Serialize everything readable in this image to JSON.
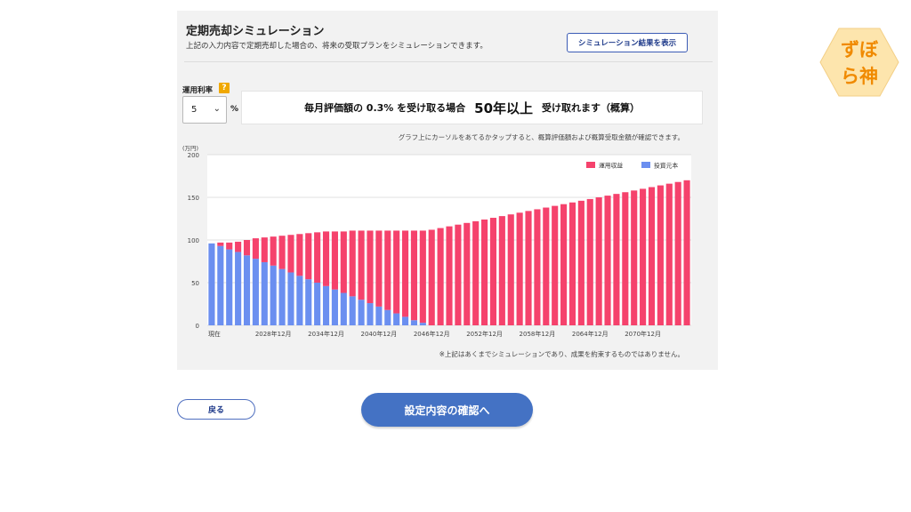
{
  "header": {
    "title": "定期売却シミュレーション",
    "description": "上記の入力内容で定期売却した場合の、将来の受取プランをシミュレーションできます。",
    "sim_button": "シミュレーション結果を表示"
  },
  "rate": {
    "label": "運用利率",
    "help": "?",
    "value": "5",
    "unit": "%"
  },
  "result": {
    "prefix": "毎月評価額の 0.3% を受け取る場合",
    "years": "50年以上",
    "suffix": "受け取れます（概算）"
  },
  "hint": "グラフ上にカーソルをあてるかタップすると、概算評価額および概算受取金額が確認できます。",
  "note": "※上記はあくまでシミュレーションであり、成果を約束するものではありません。",
  "buttons": {
    "back": "戻る",
    "confirm": "設定内容の確認へ"
  },
  "logo": {
    "line1": "ずぼ",
    "line2": "ら神"
  },
  "colors": {
    "gains": "#f5426c",
    "principal": "#6b8ff0",
    "accent": "#4472c4",
    "logo_bg": "#fde5ad",
    "logo_text": "#f08a00"
  },
  "chart_data": {
    "type": "bar",
    "stacked": true,
    "unit_label": "(万円)",
    "ylim": [
      0,
      200
    ],
    "yticks": [
      0,
      50,
      100,
      150,
      200
    ],
    "x_tick_labels": [
      {
        "index": 0,
        "label": "現在"
      },
      {
        "index": 7,
        "label": "2028年12月"
      },
      {
        "index": 13,
        "label": "2034年12月"
      },
      {
        "index": 19,
        "label": "2040年12月"
      },
      {
        "index": 25,
        "label": "2046年12月"
      },
      {
        "index": 31,
        "label": "2052年12月"
      },
      {
        "index": 37,
        "label": "2058年12月"
      },
      {
        "index": 43,
        "label": "2064年12月"
      },
      {
        "index": 49,
        "label": "2070年12月"
      }
    ],
    "legend_position": "top-right",
    "series": [
      {
        "name": "投資元本",
        "color": "#6b8ff0",
        "values": [
          96,
          93,
          89,
          86,
          82,
          78,
          74,
          70,
          66,
          62,
          58,
          54,
          50,
          46,
          42,
          38,
          34,
          30,
          26,
          22,
          18,
          14,
          10,
          6,
          3,
          0,
          0,
          0,
          0,
          0,
          0,
          0,
          0,
          0,
          0,
          0,
          0,
          0,
          0,
          0,
          0,
          0,
          0,
          0,
          0,
          0,
          0,
          0,
          0,
          0,
          0,
          0,
          0,
          0,
          0
        ]
      },
      {
        "name": "運用収益",
        "color": "#f5426c",
        "values": [
          0,
          4,
          8,
          12,
          18,
          24,
          29,
          34,
          39,
          44,
          49,
          54,
          59,
          64,
          68,
          72,
          77,
          81,
          85,
          89,
          93,
          97,
          101,
          105,
          108,
          112,
          114,
          116,
          118,
          120,
          122,
          124,
          126,
          128,
          130,
          132,
          134,
          136,
          138,
          140,
          142,
          144,
          146,
          148,
          150,
          152,
          154,
          156,
          158,
          160,
          162,
          164,
          166,
          168,
          170
        ]
      }
    ]
  }
}
